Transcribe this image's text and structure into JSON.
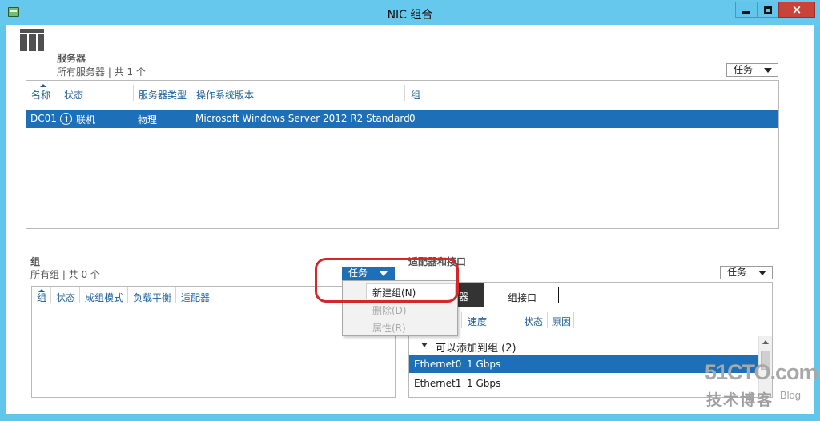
{
  "window": {
    "title": "NIC 组合",
    "icon": "network-adapter-icon",
    "controls": {
      "minimize": "minimize-icon",
      "maximize": "maximize-icon",
      "close": "×"
    }
  },
  "servers": {
    "title": "服务器",
    "subtitle": "所有服务器 | 共 1 个",
    "tasks_label": "任务",
    "columns": [
      "名称",
      "状态",
      "服务器类型",
      "操作系统版本",
      "组"
    ],
    "rows": [
      {
        "name": "DC01",
        "status": "联机",
        "type": "物理",
        "os": "Microsoft Windows Server 2012 R2 Standard",
        "groups": "0",
        "selected": true
      }
    ]
  },
  "teams": {
    "title": "组",
    "subtitle": "所有组 | 共 0 个",
    "tasks_label": "任务",
    "columns": [
      "组",
      "状态",
      "成组模式",
      "负载平衡",
      "适配器"
    ]
  },
  "tasks_menu": {
    "items": [
      {
        "label": "新建组(N)",
        "enabled": true
      },
      {
        "label": "删除(D)",
        "enabled": false
      },
      {
        "label": "属性(R)",
        "enabled": false
      }
    ]
  },
  "adapters": {
    "title": "适配器和接口",
    "tasks_label": "任务",
    "tabs": [
      {
        "label": "器",
        "active": true
      },
      {
        "label": "组接口",
        "active": false
      }
    ],
    "columns": [
      "速度",
      "状态",
      "原因"
    ],
    "group_header": "可以添加到组 (2)",
    "rows": [
      {
        "name": "Ethernet0",
        "speed": "1 Gbps",
        "selected": true
      },
      {
        "name": "Ethernet1",
        "speed": "1 Gbps",
        "selected": false
      }
    ]
  },
  "watermark": {
    "line1": "51CTO.com",
    "line2": "技术博客",
    "line3": "Blog"
  },
  "colors": {
    "title_bar": "#66c8ec",
    "selection": "#1d6fb7",
    "header_text": "#1f5f99",
    "annotation": "#d6262a",
    "close_button": "#c9433a"
  }
}
